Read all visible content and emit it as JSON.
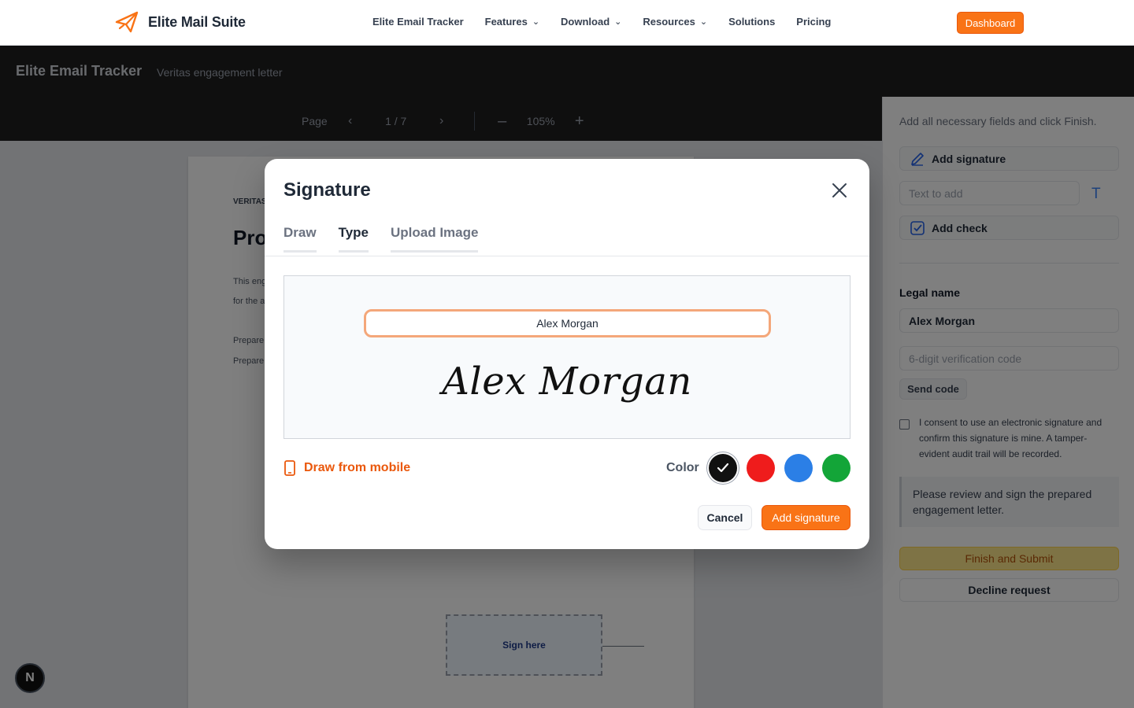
{
  "topnav": {
    "brand": "Elite Mail Suite",
    "links": [
      {
        "label": "Elite Email Tracker",
        "dropdown": false
      },
      {
        "label": "Features",
        "dropdown": true
      },
      {
        "label": "Download",
        "dropdown": true
      },
      {
        "label": "Resources",
        "dropdown": true
      },
      {
        "label": "Solutions",
        "dropdown": false
      },
      {
        "label": "Pricing",
        "dropdown": false
      }
    ],
    "dashboard": "Dashboard",
    "accent": "#f97316"
  },
  "header": {
    "title": "Elite Email Tracker",
    "subtitle": "Veritas engagement letter",
    "page_label": "Page",
    "page_count": "1 / 7",
    "zoom": "105%"
  },
  "document": {
    "eyebrow": "VERITAS",
    "title": "Pro",
    "lines": [
      "This eng",
      "for the a",
      "Prepare",
      "Prepare"
    ],
    "sign_here": "Sign here"
  },
  "panel": {
    "hint": "Add all necessary fields and click Finish.",
    "add_signature": "Add signature",
    "text_placeholder": "Text to add",
    "add_check": "Add check",
    "legal_name_label": "Legal name",
    "legal_name_value": "Alex Morgan",
    "code_placeholder": "6-digit verification code",
    "send_code": "Send code",
    "consent": "I consent to use an electronic signature and confirm this signature is mine. A tamper-evident audit trail will be recorded.",
    "note": "Please review and sign the prepared engagement letter.",
    "finish": "Finish and Submit",
    "decline": "Decline request"
  },
  "modal": {
    "title": "Signature",
    "tabs": [
      {
        "label": "Draw",
        "active": false
      },
      {
        "label": "Type",
        "active": true
      },
      {
        "label": "Upload Image",
        "active": false
      }
    ],
    "name_input": "Alex Morgan",
    "preview": "Alex Morgan",
    "draw_mobile": "Draw from mobile",
    "color_label": "Color",
    "colors": [
      "#111111",
      "#ef1c1c",
      "#2b7fe6",
      "#13a538"
    ],
    "selected_color": "#111111",
    "cancel": "Cancel",
    "add": "Add signature"
  },
  "badge": "N"
}
